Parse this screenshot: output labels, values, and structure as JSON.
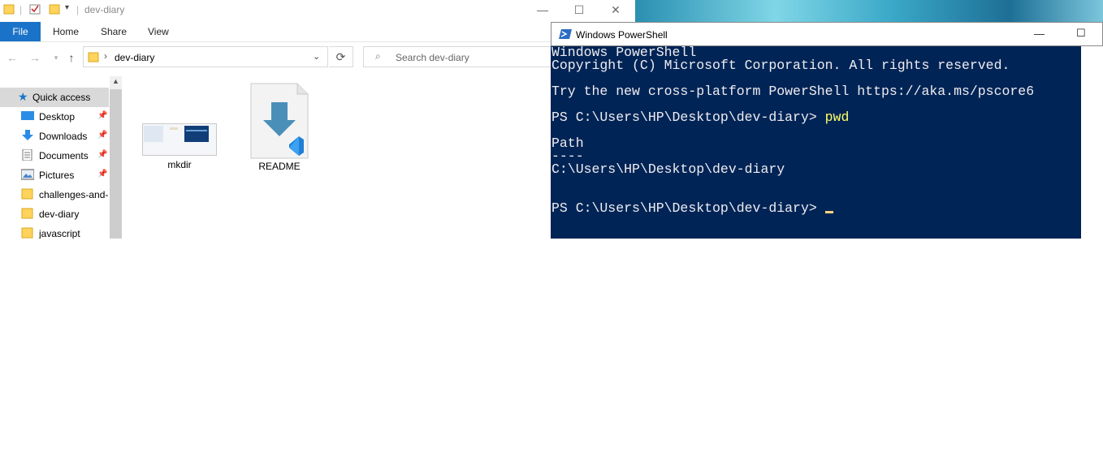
{
  "explorer": {
    "title": "dev-diary",
    "ribbon_tabs": [
      "File",
      "Home",
      "Share",
      "View"
    ],
    "address_path": "dev-diary",
    "search_placeholder": "Search dev-diary",
    "sidebar": {
      "quick_access": "Quick access",
      "items": [
        {
          "label": "Desktop",
          "icon": "desktop-icon",
          "pinned": true
        },
        {
          "label": "Downloads",
          "icon": "download-icon",
          "pinned": true
        },
        {
          "label": "Documents",
          "icon": "document-icon",
          "pinned": true
        },
        {
          "label": "Pictures",
          "icon": "pictures-icon",
          "pinned": true
        },
        {
          "label": "challenges-and-",
          "icon": "folder-icon",
          "pinned": false
        },
        {
          "label": "dev-diary",
          "icon": "folder-icon",
          "pinned": false
        },
        {
          "label": "javascript",
          "icon": "folder-icon",
          "pinned": false
        }
      ]
    },
    "files": [
      {
        "name": "mkdir",
        "icon": "image-thumbnail-icon"
      },
      {
        "name": "README",
        "icon": "vscode-markdown-file-icon"
      }
    ]
  },
  "powershell": {
    "title": "Windows PowerShell",
    "lines": [
      {
        "text": "Windows PowerShell"
      },
      {
        "text": "Copyright (C) Microsoft Corporation. All rights reserved."
      },
      {
        "text": ""
      },
      {
        "text": "Try the new cross-platform PowerShell https://aka.ms/pscore6"
      },
      {
        "text": ""
      },
      {
        "text": "PS C:\\Users\\HP\\Desktop\\dev-diary> ",
        "cmd": "pwd"
      },
      {
        "text": ""
      },
      {
        "text": "Path"
      },
      {
        "text": "----"
      },
      {
        "text": "C:\\Users\\HP\\Desktop\\dev-diary"
      },
      {
        "text": ""
      },
      {
        "text": ""
      },
      {
        "text": "PS C:\\Users\\HP\\Desktop\\dev-diary> ",
        "cursor": true
      }
    ],
    "colors": {
      "background": "#012456",
      "foreground": "#eeedf0",
      "command": "#ffff66"
    }
  },
  "colors": {
    "accent": "#1a73c8",
    "folder": "#ffd35c"
  }
}
